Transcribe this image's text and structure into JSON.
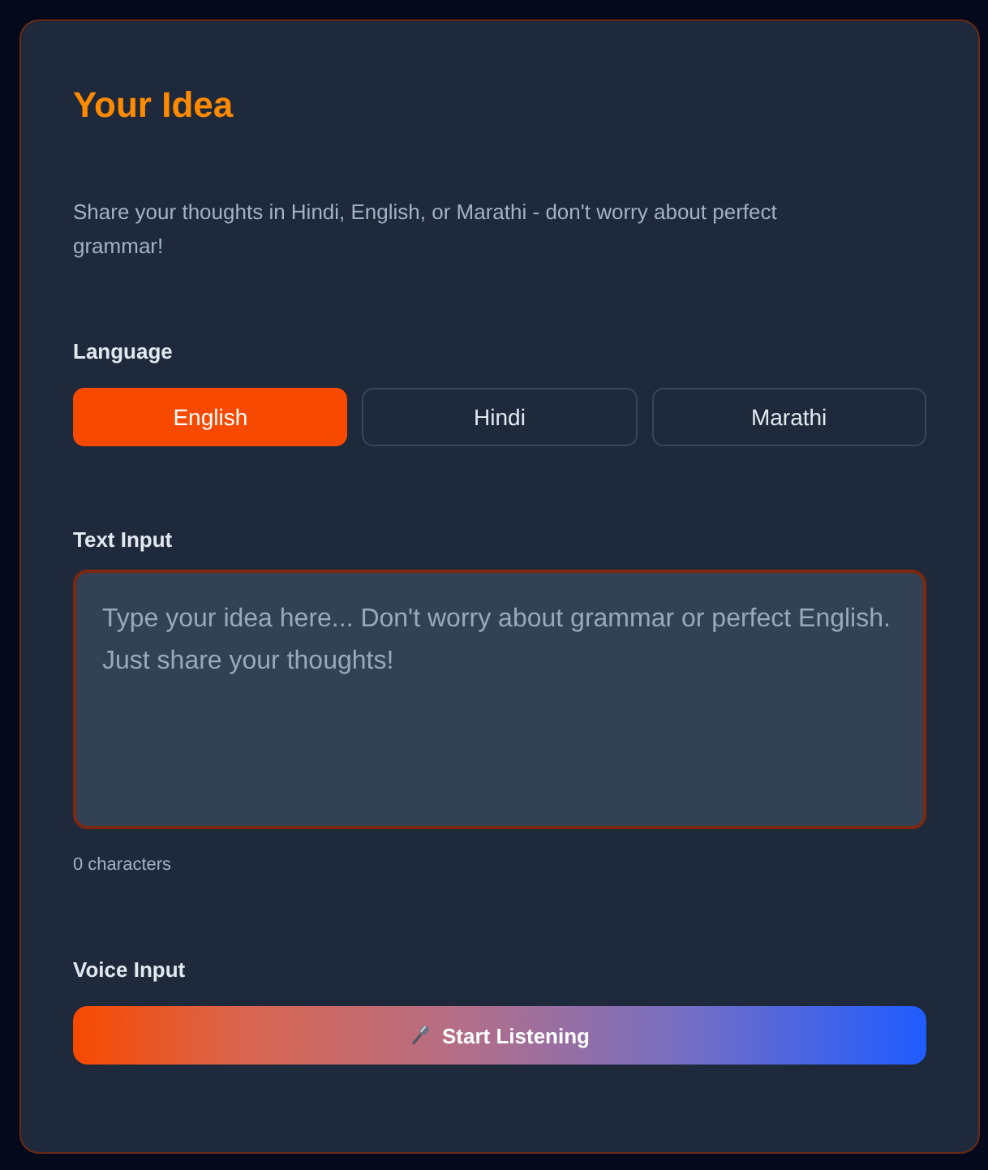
{
  "panel": {
    "title": "Your Idea",
    "description": "Share your thoughts in Hindi, English, or Marathi - don't worry about perfect grammar!"
  },
  "language": {
    "label": "Language",
    "options": [
      {
        "label": "English",
        "selected": true
      },
      {
        "label": "Hindi",
        "selected": false
      },
      {
        "label": "Marathi",
        "selected": false
      }
    ]
  },
  "text_input": {
    "label": "Text Input",
    "placeholder": "Type your idea here... Don't worry about grammar or perfect English. Just share your thoughts!",
    "character_count": "0 characters"
  },
  "voice_input": {
    "label": "Voice Input",
    "button": "Start Listening"
  }
}
